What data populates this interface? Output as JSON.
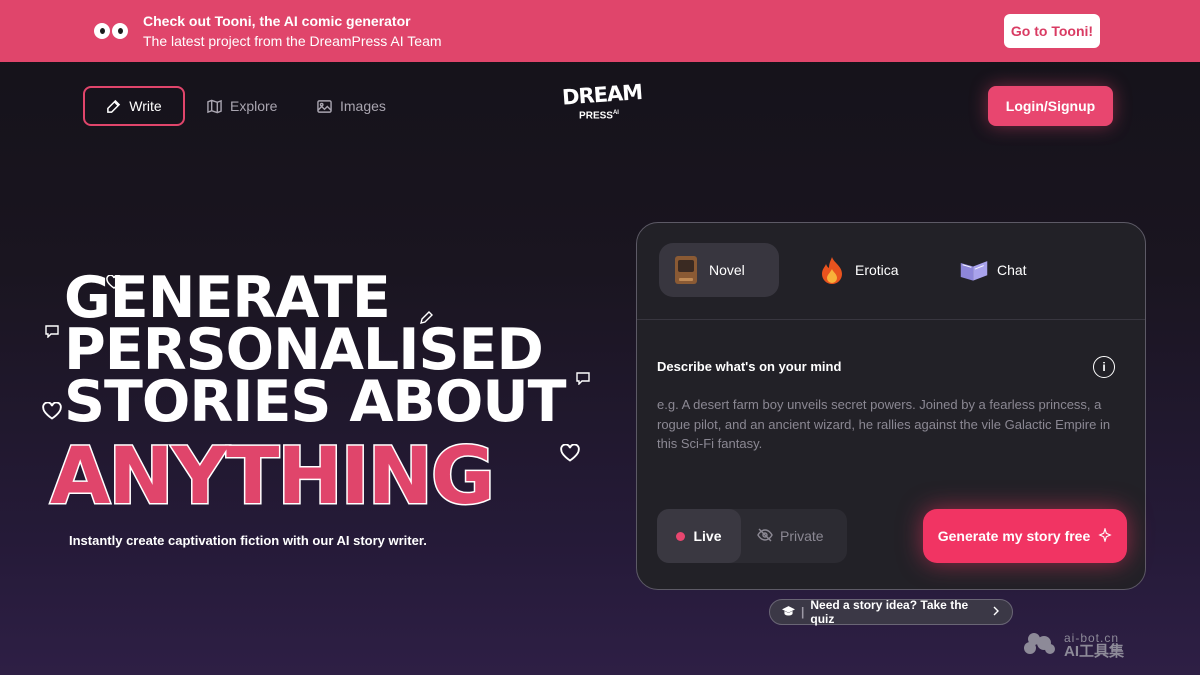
{
  "banner": {
    "title": "Check out Tooni, the AI comic generator",
    "subtitle": "The latest project from the DreamPress AI Team",
    "cta_label": "Go to Tooni!"
  },
  "nav": {
    "write_label": "Write",
    "explore_label": "Explore",
    "images_label": "Images",
    "login_label": "Login/Signup"
  },
  "logo": {
    "line1": "DREAM",
    "line2": "PRESS",
    "suffix": "AI"
  },
  "hero": {
    "line1": "GENERATE",
    "line2": "PERSONALISED",
    "line3": "STORIES ABOUT",
    "highlight": "ANYTHING",
    "subtitle": "Instantly create captivation fiction with our AI story writer."
  },
  "card": {
    "tabs": [
      {
        "label": "Novel",
        "icon": "book-icon",
        "active": true
      },
      {
        "label": "Erotica",
        "icon": "flame-icon",
        "active": false
      },
      {
        "label": "Chat",
        "icon": "chat-book-icon",
        "active": false
      }
    ],
    "prompt_label": "Describe what's on your mind",
    "prompt_placeholder": "e.g. A desert farm boy unveils secret powers. Joined by a fearless princess, a rogue pilot, and an ancient wizard, he rallies against the vile Galactic Empire in this Sci-Fi fantasy.",
    "visibility": {
      "live_label": "Live",
      "private_label": "Private",
      "selected": "Live"
    },
    "generate_label": "Generate my story free"
  },
  "quiz": {
    "separator": "|",
    "label": "Need a story idea? Take the quiz"
  },
  "watermark": {
    "url": "ai-bot.cn",
    "name": "AI工具集"
  },
  "colors": {
    "accent": "#e0456b",
    "button": "#f13463",
    "card_bg": "#222127"
  }
}
